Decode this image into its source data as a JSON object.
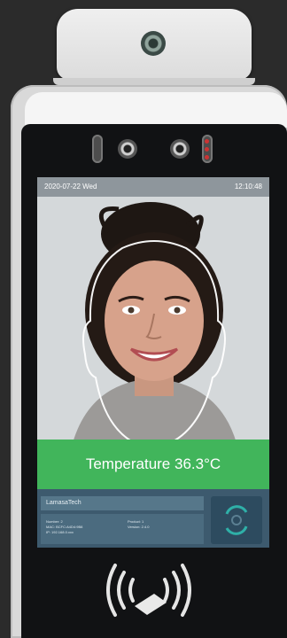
{
  "status": {
    "date": "2020-07-22 Wed",
    "time": "12:10:48"
  },
  "temperature": {
    "label": "Temperature 36.3°C",
    "color": "#41b55b"
  },
  "info": {
    "brand": "LamasaTech",
    "number": "Number: 2",
    "mac": "MAC: BCFC:A4D4:9B8",
    "ip": "IP: 192.168.0.xxx",
    "product": "Product: 1",
    "version": "Version: 2.4.0"
  },
  "icons": [
    "camera-lens-icon",
    "ir-sensor-icon",
    "face-scan-icon",
    "nfc-reader-icon"
  ]
}
